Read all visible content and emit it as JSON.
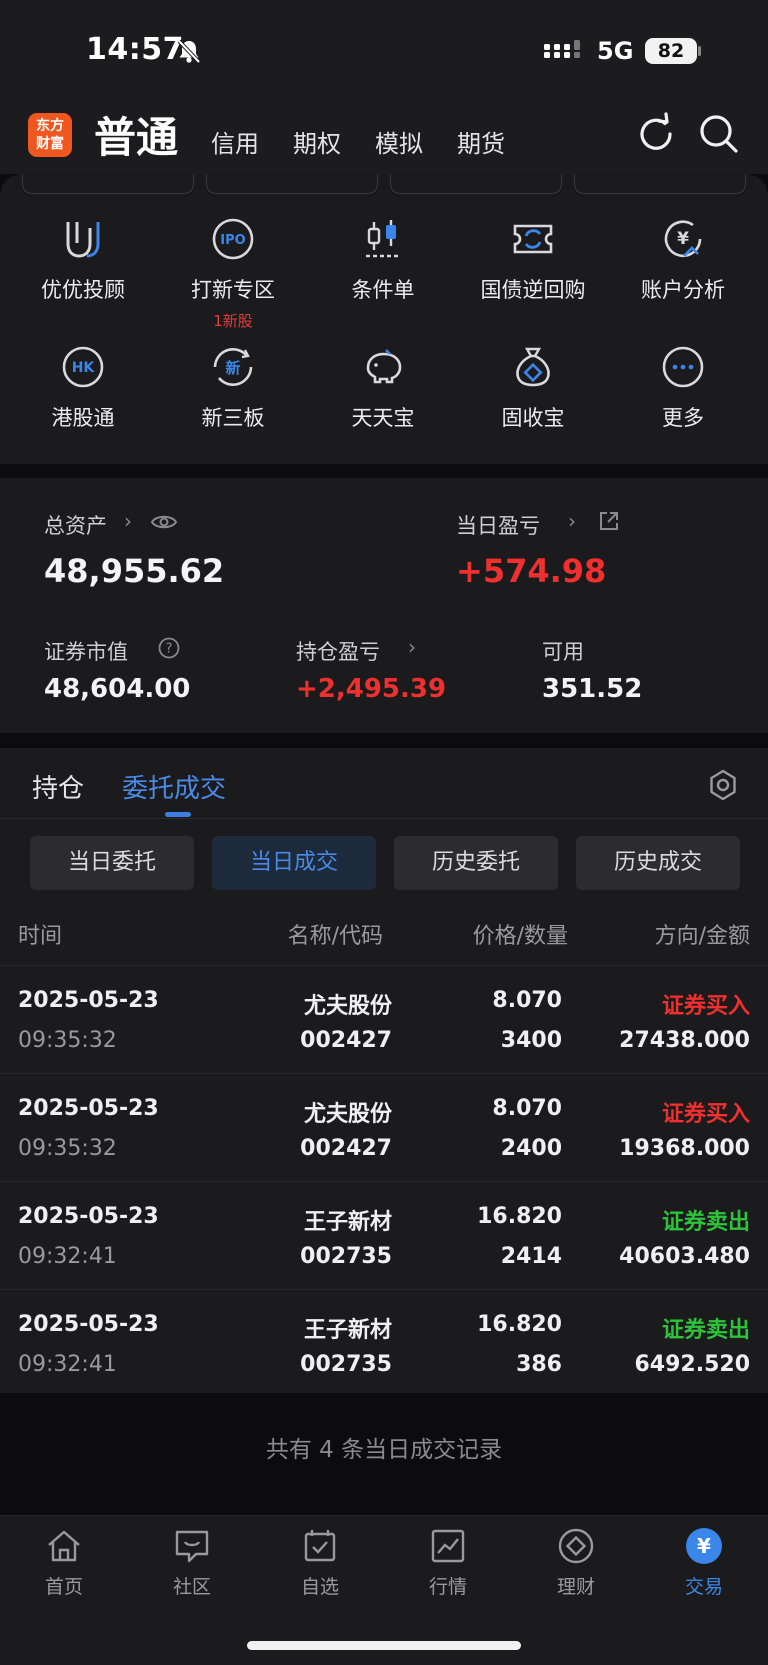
{
  "status_bar": {
    "time": "14:57",
    "network": "5G",
    "battery": "82"
  },
  "header": {
    "logo_line1": "东方",
    "logo_line2": "财富",
    "account_type": "普通",
    "tabs": [
      "信用",
      "期权",
      "模拟",
      "期货"
    ],
    "icons": [
      "refresh-icon",
      "search-icon"
    ]
  },
  "quick_grid": [
    {
      "label": "优优投顾",
      "icon": "uu-advisor-icon"
    },
    {
      "label": "打新专区",
      "sub": "1新股",
      "icon": "ipo-icon"
    },
    {
      "label": "条件单",
      "icon": "candlestick-icon"
    },
    {
      "label": "国债逆回购",
      "icon": "repo-icon"
    },
    {
      "label": "账户分析",
      "icon": "yuan-chart-icon"
    },
    {
      "label": "港股通",
      "icon": "hk-icon"
    },
    {
      "label": "新三板",
      "icon": "new-board-icon"
    },
    {
      "label": "天天宝",
      "icon": "piggy-bank-icon"
    },
    {
      "label": "固收宝",
      "icon": "money-bag-icon"
    },
    {
      "label": "更多",
      "icon": "more-icon"
    }
  ],
  "assets": {
    "total_label": "总资产",
    "total_value": "48,955.62",
    "daily_pl_label": "当日盈亏",
    "daily_pl_value": "+574.98",
    "market_value_label": "证券市值",
    "market_value": "48,604.00",
    "position_pl_label": "持仓盈亏",
    "position_pl_value": "+2,495.39",
    "available_label": "可用",
    "available_value": "351.52"
  },
  "tabs": {
    "positions": "持仓",
    "orders": "委托成交",
    "sub": [
      "当日委托",
      "当日成交",
      "历史委托",
      "历史成交"
    ],
    "active_sub": 1
  },
  "table": {
    "headers": [
      "时间",
      "名称/代码",
      "价格/数量",
      "方向/金额"
    ],
    "rows": [
      {
        "date": "2025-05-23",
        "time": "09:35:32",
        "name": "尤夫股份",
        "code": "002427",
        "price": "8.070",
        "qty": "3400",
        "direction": "证券买入",
        "amount": "27438.000",
        "side": "buy"
      },
      {
        "date": "2025-05-23",
        "time": "09:35:32",
        "name": "尤夫股份",
        "code": "002427",
        "price": "8.070",
        "qty": "2400",
        "direction": "证券买入",
        "amount": "19368.000",
        "side": "buy"
      },
      {
        "date": "2025-05-23",
        "time": "09:32:41",
        "name": "王子新材",
        "code": "002735",
        "price": "16.820",
        "qty": "2414",
        "direction": "证券卖出",
        "amount": "40603.480",
        "side": "sell"
      },
      {
        "date": "2025-05-23",
        "time": "09:32:41",
        "name": "王子新材",
        "code": "002735",
        "price": "16.820",
        "qty": "386",
        "direction": "证券卖出",
        "amount": "6492.520",
        "side": "sell"
      }
    ],
    "summary": "共有 4 条当日成交记录"
  },
  "bottom_nav": [
    {
      "label": "首页",
      "icon": "home-icon"
    },
    {
      "label": "社区",
      "icon": "community-icon"
    },
    {
      "label": "自选",
      "icon": "watchlist-icon"
    },
    {
      "label": "行情",
      "icon": "market-chart-icon"
    },
    {
      "label": "理财",
      "icon": "wealth-icon"
    },
    {
      "label": "交易",
      "icon": "trade-yuan-icon",
      "active": true
    }
  ],
  "colors": {
    "accent": "#3b7de0",
    "up": "#f0302f",
    "down": "#2ec43a",
    "logo": "#f0561f"
  }
}
